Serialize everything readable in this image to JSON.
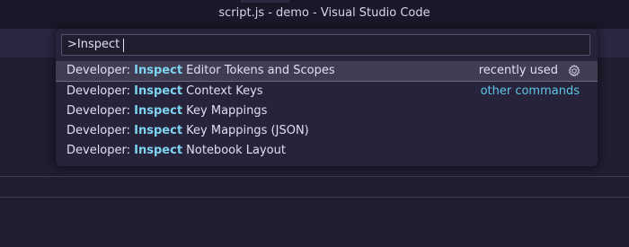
{
  "window": {
    "title": "script.js - demo - Visual Studio Code"
  },
  "command_palette": {
    "input_value": ">Inspect",
    "items": [
      {
        "prefix": "Developer: ",
        "match": "Inspect",
        "suffix": " Editor Tokens and Scopes",
        "label": "recently used",
        "selected": true
      },
      {
        "prefix": "Developer: ",
        "match": "Inspect",
        "suffix": " Context Keys",
        "label": "other commands"
      },
      {
        "prefix": "Developer: ",
        "match": "Inspect",
        "suffix": " Key Mappings"
      },
      {
        "prefix": "Developer: ",
        "match": "Inspect",
        "suffix": " Key Mappings (JSON)"
      },
      {
        "prefix": "Developer: ",
        "match": "Inspect",
        "suffix": " Notebook Layout"
      }
    ]
  },
  "icons": {
    "gear": "gear-icon"
  },
  "colors": {
    "background": "#1f1d2e",
    "palette_background": "#26233a",
    "selection": "#403d52",
    "match_highlight": "#7fd4f2",
    "separator_label": "#5fc6e8",
    "text": "#e0def4"
  }
}
